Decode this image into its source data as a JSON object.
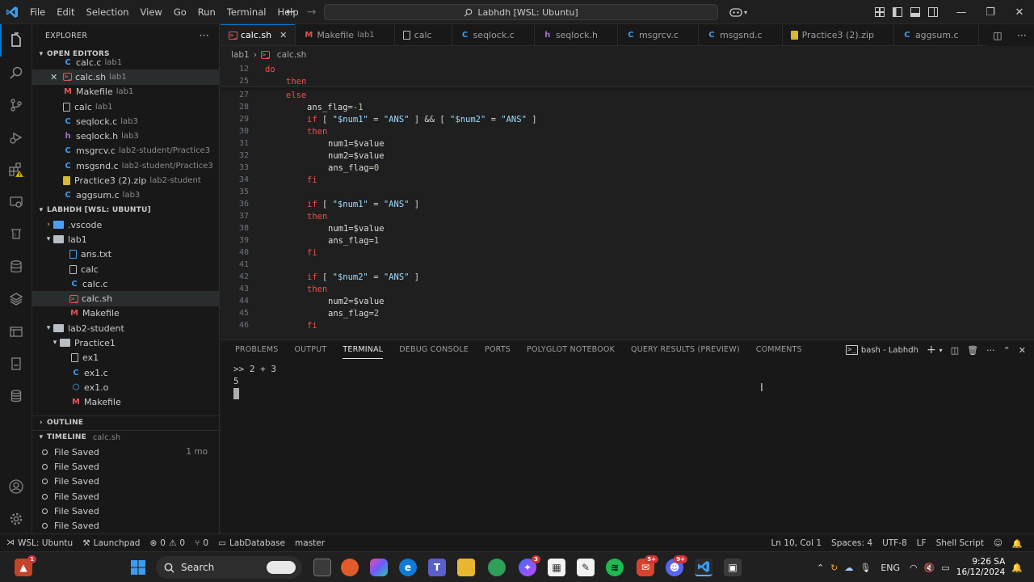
{
  "menu": [
    "File",
    "Edit",
    "Selection",
    "View",
    "Go",
    "Run",
    "Terminal",
    "Help"
  ],
  "command_center": "Labhdh [WSL: Ubuntu]",
  "explorer": {
    "title": "EXPLORER",
    "open_editors_label": "OPEN EDITORS",
    "open_editors": [
      {
        "name": "calc.c",
        "desc": "lab1",
        "icon": "c"
      },
      {
        "name": "calc.sh",
        "desc": "lab1",
        "icon": "sh"
      },
      {
        "name": "Makefile",
        "desc": "lab1",
        "icon": "makefile"
      },
      {
        "name": "calc",
        "desc": "lab1",
        "icon": "file"
      },
      {
        "name": "seqlock.c",
        "desc": "lab3",
        "icon": "c"
      },
      {
        "name": "seqlock.h",
        "desc": "lab3",
        "icon": "h"
      },
      {
        "name": "msgrcv.c",
        "desc": "lab2-student/Practice3",
        "icon": "c"
      },
      {
        "name": "msgsnd.c",
        "desc": "lab2-student/Practice3",
        "icon": "c"
      },
      {
        "name": "Practice3 (2).zip",
        "desc": "lab2-student",
        "icon": "zip"
      },
      {
        "name": "aggsum.c",
        "desc": "lab3",
        "icon": "c"
      }
    ],
    "workspace_label": "LABHDH [WSL: UBUNTU]",
    "tree": [
      {
        "name": ".vscode",
        "type": "folder",
        "depth": 0,
        "open": false
      },
      {
        "name": "lab1",
        "type": "folder",
        "depth": 0,
        "open": true
      },
      {
        "name": "ans.txt",
        "type": "txt",
        "depth": 1
      },
      {
        "name": "calc",
        "type": "file",
        "depth": 1
      },
      {
        "name": "calc.c",
        "type": "c",
        "depth": 1
      },
      {
        "name": "calc.sh",
        "type": "sh",
        "depth": 1
      },
      {
        "name": "Makefile",
        "type": "makefile",
        "depth": 1
      },
      {
        "name": "lab2-student",
        "type": "folder",
        "depth": 0,
        "open": true
      },
      {
        "name": "Practice1",
        "type": "folder",
        "depth": 1,
        "open": true
      },
      {
        "name": "ex1",
        "type": "file",
        "depth": 2
      },
      {
        "name": "ex1.c",
        "type": "c",
        "depth": 2
      },
      {
        "name": "ex1.o",
        "type": "obj",
        "depth": 2
      },
      {
        "name": "Makefile",
        "type": "makefile",
        "depth": 2
      }
    ],
    "outline_label": "OUTLINE",
    "timeline_label": "TIMELINE",
    "timeline_file": "calc.sh",
    "timeline": [
      {
        "label": "File Saved",
        "time": "1 mo"
      },
      {
        "label": "File Saved",
        "time": ""
      },
      {
        "label": "File Saved",
        "time": ""
      },
      {
        "label": "File Saved",
        "time": ""
      },
      {
        "label": "File Saved",
        "time": ""
      },
      {
        "label": "File Saved",
        "time": ""
      }
    ]
  },
  "tabs": [
    {
      "name": "calc.sh",
      "desc": "",
      "icon": "sh",
      "active": true
    },
    {
      "name": "Makefile",
      "desc": "lab1",
      "icon": "makefile"
    },
    {
      "name": "calc",
      "desc": "",
      "icon": "file"
    },
    {
      "name": "seqlock.c",
      "desc": "",
      "icon": "c"
    },
    {
      "name": "seqlock.h",
      "desc": "",
      "icon": "h"
    },
    {
      "name": "msgrcv.c",
      "desc": "",
      "icon": "c"
    },
    {
      "name": "msgsnd.c",
      "desc": "",
      "icon": "c"
    },
    {
      "name": "Practice3 (2).zip",
      "desc": "",
      "icon": "zip"
    },
    {
      "name": "aggsum.c",
      "desc": "",
      "icon": "c"
    }
  ],
  "breadcrumb": [
    "lab1",
    "calc.sh"
  ],
  "sticky_lines": [
    {
      "n": "12",
      "indent": 0,
      "tokens": [
        [
          "kw",
          "do"
        ]
      ]
    },
    {
      "n": "25",
      "indent": 1,
      "tokens": [
        [
          "kw",
          "then"
        ]
      ]
    }
  ],
  "code_lines": [
    {
      "n": "27",
      "indent": 1,
      "tokens": [
        [
          "kw",
          "else"
        ]
      ]
    },
    {
      "n": "28",
      "indent": 2,
      "tokens": [
        [
          "var",
          "ans_flag"
        ],
        [
          "op",
          "="
        ],
        [
          "num",
          "-1"
        ]
      ]
    },
    {
      "n": "29",
      "indent": 2,
      "tokens": [
        [
          "kw",
          "if"
        ],
        [
          "op",
          " [ "
        ],
        [
          "str",
          "\"$num1\""
        ],
        [
          "op",
          " = "
        ],
        [
          "str",
          "\"ANS\""
        ],
        [
          "op",
          " ] && [ "
        ],
        [
          "str",
          "\"$num2\""
        ],
        [
          "op",
          " = "
        ],
        [
          "str",
          "\"ANS\""
        ],
        [
          "op",
          " ]"
        ]
      ]
    },
    {
      "n": "30",
      "indent": 2,
      "tokens": [
        [
          "kw",
          "then"
        ]
      ]
    },
    {
      "n": "31",
      "indent": 3,
      "tokens": [
        [
          "var",
          "num1"
        ],
        [
          "op",
          "="
        ],
        [
          "var",
          "$value"
        ]
      ]
    },
    {
      "n": "32",
      "indent": 3,
      "tokens": [
        [
          "var",
          "num2"
        ],
        [
          "op",
          "="
        ],
        [
          "var",
          "$value"
        ]
      ]
    },
    {
      "n": "33",
      "indent": 3,
      "tokens": [
        [
          "var",
          "ans_flag"
        ],
        [
          "op",
          "="
        ],
        [
          "num",
          "0"
        ]
      ]
    },
    {
      "n": "34",
      "indent": 2,
      "tokens": [
        [
          "kw",
          "fi"
        ]
      ]
    },
    {
      "n": "35",
      "indent": 0,
      "tokens": []
    },
    {
      "n": "36",
      "indent": 2,
      "tokens": [
        [
          "kw",
          "if"
        ],
        [
          "op",
          " [ "
        ],
        [
          "str",
          "\"$num1\""
        ],
        [
          "op",
          " = "
        ],
        [
          "str",
          "\"ANS\""
        ],
        [
          "op",
          " ]"
        ]
      ]
    },
    {
      "n": "37",
      "indent": 2,
      "tokens": [
        [
          "kw",
          "then"
        ]
      ]
    },
    {
      "n": "38",
      "indent": 3,
      "tokens": [
        [
          "var",
          "num1"
        ],
        [
          "op",
          "="
        ],
        [
          "var",
          "$value"
        ]
      ]
    },
    {
      "n": "39",
      "indent": 3,
      "tokens": [
        [
          "var",
          "ans_flag"
        ],
        [
          "op",
          "="
        ],
        [
          "num",
          "1"
        ]
      ]
    },
    {
      "n": "40",
      "indent": 2,
      "tokens": [
        [
          "kw",
          "fi"
        ]
      ]
    },
    {
      "n": "41",
      "indent": 0,
      "tokens": []
    },
    {
      "n": "42",
      "indent": 2,
      "tokens": [
        [
          "kw",
          "if"
        ],
        [
          "op",
          " [ "
        ],
        [
          "str",
          "\"$num2\""
        ],
        [
          "op",
          " = "
        ],
        [
          "str",
          "\"ANS\""
        ],
        [
          "op",
          " ]"
        ]
      ]
    },
    {
      "n": "43",
      "indent": 2,
      "tokens": [
        [
          "kw",
          "then"
        ]
      ]
    },
    {
      "n": "44",
      "indent": 3,
      "tokens": [
        [
          "var",
          "num2"
        ],
        [
          "op",
          "="
        ],
        [
          "var",
          "$value"
        ]
      ]
    },
    {
      "n": "45",
      "indent": 3,
      "tokens": [
        [
          "var",
          "ans_flag"
        ],
        [
          "op",
          "="
        ],
        [
          "num",
          "2"
        ]
      ]
    },
    {
      "n": "46",
      "indent": 2,
      "tokens": [
        [
          "kw",
          "fi"
        ]
      ]
    }
  ],
  "panel": {
    "tabs": [
      "PROBLEMS",
      "OUTPUT",
      "TERMINAL",
      "DEBUG CONSOLE",
      "PORTS",
      "POLYGLOT NOTEBOOK",
      "QUERY RESULTS (PREVIEW)",
      "COMMENTS"
    ],
    "active_tab": "TERMINAL",
    "terminal_name": "bash - Labhdh",
    "terminal_lines": [
      ">> 2 + 3",
      "5"
    ]
  },
  "statusbar": {
    "remote": "WSL: Ubuntu",
    "launchpad": "Launchpad",
    "errors": "0",
    "warnings": "0",
    "ports": "0",
    "database": "LabDatabase",
    "branch": "master",
    "position": "Ln 10, Col 1",
    "spaces": "Spaces: 4",
    "encoding": "UTF-8",
    "eol": "LF",
    "language": "Shell Script"
  },
  "taskbar": {
    "search_label": "Search",
    "lang": "ENG",
    "time": "9:26 SA",
    "date": "16/12/2024",
    "badge_left": "1",
    "badge_messenger": "3",
    "badge_mail": "5+",
    "badge_discord": "9+"
  },
  "colors": {
    "accent": "#0078d4",
    "keyword": "#f14c4c",
    "string": "#9cdcfe"
  }
}
